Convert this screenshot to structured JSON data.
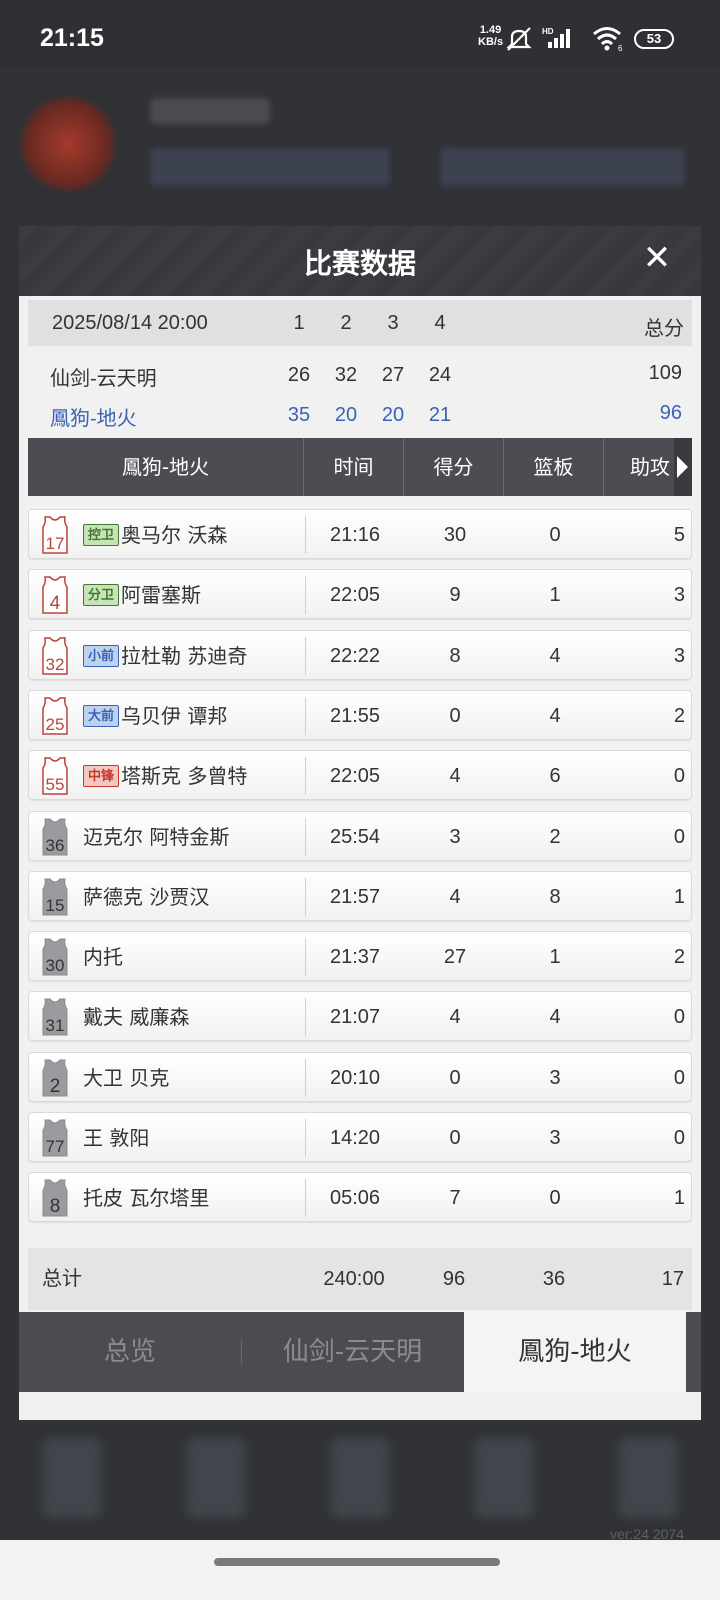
{
  "status_bar": {
    "time": "21:15",
    "net_speed_value": "1.49",
    "net_speed_unit": "KB/s",
    "battery": "53",
    "icons": [
      "mute-icon",
      "hd-signal-icon",
      "wifi-icon",
      "battery-icon"
    ]
  },
  "modal": {
    "title": "比赛数据",
    "close": "✕"
  },
  "scoreboard": {
    "date": "2025/08/14 20:00",
    "quarters": [
      "1",
      "2",
      "3",
      "4"
    ],
    "total_label": "总分",
    "teams": [
      {
        "name": "仙剑-云天明",
        "q": [
          "26",
          "32",
          "27",
          "24"
        ],
        "total": "109",
        "color": "#333333"
      },
      {
        "name": "鳳狗-地火",
        "q": [
          "35",
          "20",
          "20",
          "21"
        ],
        "total": "96",
        "color": "#3b62b6"
      }
    ]
  },
  "table": {
    "team_name": "鳳狗-地火",
    "columns": [
      "时间",
      "得分",
      "篮板",
      "助攻"
    ],
    "players": [
      {
        "number": "17",
        "position": "控卫",
        "name": "奥马尔 沃森",
        "time": "21:16",
        "points": "30",
        "rebounds": "0",
        "assists": "5",
        "starter": true
      },
      {
        "number": "4",
        "position": "分卫",
        "name": "阿雷塞斯",
        "time": "22:05",
        "points": "9",
        "rebounds": "1",
        "assists": "3",
        "starter": true
      },
      {
        "number": "32",
        "position": "小前",
        "name": "拉杜勒 苏迪奇",
        "time": "22:22",
        "points": "8",
        "rebounds": "4",
        "assists": "3",
        "starter": true
      },
      {
        "number": "25",
        "position": "大前",
        "name": "乌贝伊 谭邦",
        "time": "21:55",
        "points": "0",
        "rebounds": "4",
        "assists": "2",
        "starter": true
      },
      {
        "number": "55",
        "position": "中锋",
        "name": "塔斯克 多曾特",
        "time": "22:05",
        "points": "4",
        "rebounds": "6",
        "assists": "0",
        "starter": true
      },
      {
        "number": "36",
        "position": "",
        "name": "迈克尔 阿特金斯",
        "time": "25:54",
        "points": "3",
        "rebounds": "2",
        "assists": "0",
        "starter": false
      },
      {
        "number": "15",
        "position": "",
        "name": "萨德克 沙贾汉",
        "time": "21:57",
        "points": "4",
        "rebounds": "8",
        "assists": "1",
        "starter": false
      },
      {
        "number": "30",
        "position": "",
        "name": "内托",
        "time": "21:37",
        "points": "27",
        "rebounds": "1",
        "assists": "2",
        "starter": false
      },
      {
        "number": "31",
        "position": "",
        "name": "戴夫 威廉森",
        "time": "21:07",
        "points": "4",
        "rebounds": "4",
        "assists": "0",
        "starter": false
      },
      {
        "number": "2",
        "position": "",
        "name": "大卫 贝克",
        "time": "20:10",
        "points": "0",
        "rebounds": "3",
        "assists": "0",
        "starter": false
      },
      {
        "number": "77",
        "position": "",
        "name": "王 敦阳",
        "time": "14:20",
        "points": "0",
        "rebounds": "3",
        "assists": "0",
        "starter": false
      },
      {
        "number": "8",
        "position": "",
        "name": "托皮 瓦尔塔里",
        "time": "05:06",
        "points": "7",
        "rebounds": "0",
        "assists": "1",
        "starter": false
      }
    ],
    "totals": {
      "label": "总计",
      "time": "240:00",
      "points": "96",
      "rebounds": "36",
      "assists": "17"
    }
  },
  "tabs": [
    {
      "label": "总览",
      "active": false
    },
    {
      "label": "仙剑-云天明",
      "active": false
    },
    {
      "label": "鳳狗-地火",
      "active": true
    }
  ],
  "version": "ver:24  2074",
  "position_colors": {
    "控卫": {
      "bg": "#c9e3b8",
      "fg": "#3f7a2a"
    },
    "分卫": {
      "bg": "#c9e3b8",
      "fg": "#3f7a2a"
    },
    "小前": {
      "bg": "#bcd3ef",
      "fg": "#3b62b6"
    },
    "大前": {
      "bg": "#bcd3ef",
      "fg": "#3b62b6"
    },
    "中锋": {
      "bg": "#f2c7c2",
      "fg": "#c4392b"
    }
  }
}
